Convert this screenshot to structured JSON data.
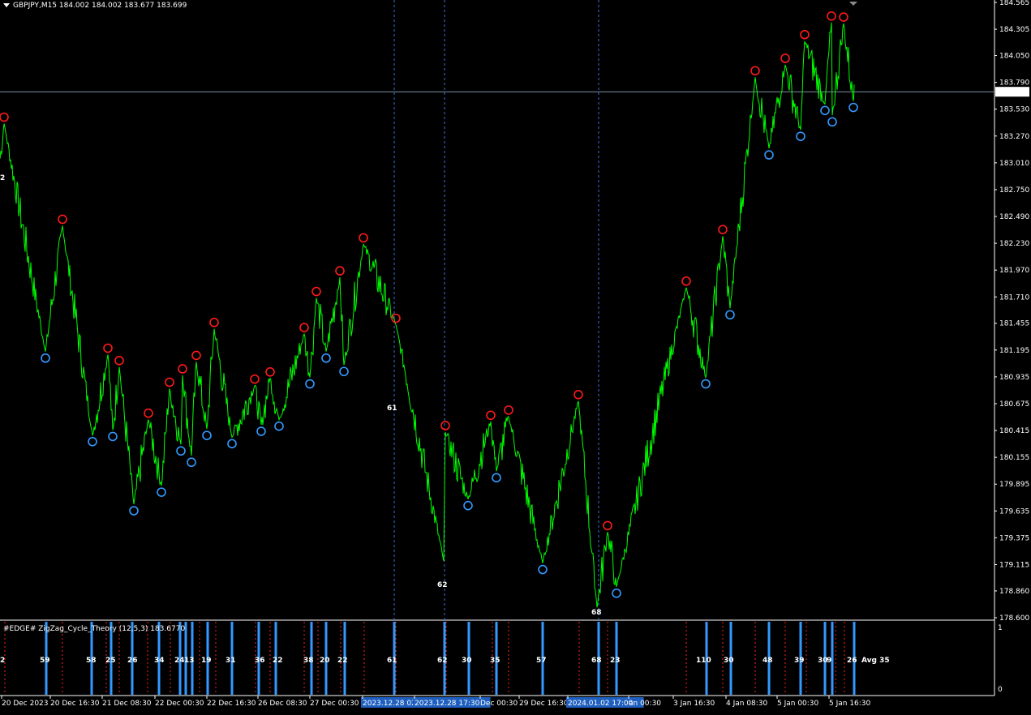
{
  "window": {
    "symbol_header": "GBPJPY,M15  184.002 184.002 183.677 183.699"
  },
  "colors": {
    "background": "#000000",
    "price_line": "#00ff00",
    "high_marker": "#ff1a1a",
    "low_marker": "#3399ff",
    "cycle_bar": "#3399ff",
    "red_dashed": "#ff2020",
    "blue_dashed": "#3a6fd8",
    "axis_text": "#ffffff",
    "current_price_line": "#7f8fa8",
    "time_highlight_bg": "#1e5fbf"
  },
  "price_axis": {
    "labels": [
      "184.565",
      "184.305",
      "184.050",
      "183.790",
      "183.530",
      "183.270",
      "183.010",
      "182.750",
      "182.490",
      "182.230",
      "181.970",
      "181.710",
      "181.455",
      "181.195",
      "180.935",
      "180.675",
      "180.415",
      "180.155",
      "179.895",
      "179.635",
      "179.375",
      "179.115",
      "178.860",
      "178.600"
    ],
    "current_price": "183.699"
  },
  "indicator": {
    "title": "#EDGE# ZigZag_Cycle_Theory (12,5,3) 183.6770",
    "axis_top": "1",
    "axis_bottom": "0",
    "avg_label": "Avg 35"
  },
  "time_axis": {
    "labels": [
      "20 Dec 2023",
      "20 Dec 16:30",
      "21 Dec 08:30",
      "22 Dec 00:30",
      "22 Dec 16:30",
      "26 Dec 08:30",
      "27 Dec 00:30",
      "2023.12.28 02",
      "2023.12.28 17:30",
      "Dec 00:30",
      "29 Dec 16:30",
      "2024.01.02 17:00",
      "an 00:30",
      "3 Jan 16:30",
      "4 Jan 08:30",
      "5 Jan 00:30",
      "5 Jan 16:30"
    ]
  },
  "chart_data": {
    "type": "line",
    "symbol": "GBPJPY",
    "timeframe": "M15",
    "ylim": [
      178.6,
      184.565
    ],
    "swing_highs": [
      {
        "time": "20 Dec 2023",
        "price": 183.39
      },
      {
        "time": "20 Dec 16:30",
        "price": 182.4
      },
      {
        "time": "21 Dec 08:30",
        "price": 181.15
      },
      {
        "time": "21 Dec 08:30",
        "price": 181.03
      },
      {
        "time": "21 Dec 08:30",
        "price": 180.52
      },
      {
        "time": "22 Dec 00:30",
        "price": 180.82
      },
      {
        "time": "22 Dec 00:30",
        "price": 180.95
      },
      {
        "time": "22 Dec 00:30",
        "price": 181.08
      },
      {
        "time": "22 Dec 00:30",
        "price": 181.4
      },
      {
        "time": "22 Dec 16:30",
        "price": 180.85
      },
      {
        "time": "26 Dec 08:30",
        "price": 180.92
      },
      {
        "time": "26 Dec 08:30",
        "price": 181.35
      },
      {
        "time": "27 Dec 00:30",
        "price": 181.7
      },
      {
        "time": "27 Dec 00:30",
        "price": 181.9
      },
      {
        "time": "27 Dec 00:30",
        "price": 182.22
      },
      {
        "time": "2023.12.28 02",
        "price": 181.44
      },
      {
        "time": "2023.12.28 17:30",
        "price": 180.4
      },
      {
        "time": "Dec 00:30",
        "price": 180.5
      },
      {
        "time": "Dec 00:30",
        "price": 180.55
      },
      {
        "time": "29 Dec 16:30",
        "price": 180.7
      },
      {
        "time": "2024.01.02 17:00",
        "price": 179.43
      },
      {
        "time": "3 Jan 16:30",
        "price": 181.8
      },
      {
        "time": "3 Jan 16:30",
        "price": 182.3
      },
      {
        "time": "4 Jan 08:30",
        "price": 183.84
      },
      {
        "time": "4 Jan 08:30",
        "price": 183.96
      },
      {
        "time": "5 Jan 00:30",
        "price": 184.19
      },
      {
        "time": "5 Jan 16:30",
        "price": 184.37
      },
      {
        "time": "5 Jan 16:30",
        "price": 184.36
      }
    ],
    "swing_lows": [
      {
        "time": "20 Dec 16:30",
        "price": 181.18
      },
      {
        "time": "21 Dec 08:30",
        "price": 180.37
      },
      {
        "time": "21 Dec 08:30",
        "price": 180.42
      },
      {
        "time": "21 Dec 08:30",
        "price": 179.7
      },
      {
        "time": "22 Dec 00:30",
        "price": 179.88
      },
      {
        "time": "22 Dec 00:30",
        "price": 180.28
      },
      {
        "time": "22 Dec 00:30",
        "price": 180.17
      },
      {
        "time": "22 Dec 16:30",
        "price": 180.43
      },
      {
        "time": "22 Dec 16:30",
        "price": 180.35
      },
      {
        "time": "26 Dec 08:30",
        "price": 180.47
      },
      {
        "time": "26 Dec 08:30",
        "price": 180.52
      },
      {
        "time": "27 Dec 00:30",
        "price": 180.93
      },
      {
        "time": "27 Dec 00:30",
        "price": 181.18
      },
      {
        "time": "27 Dec 00:30",
        "price": 181.05
      },
      {
        "time": "2023.12.28 17:30",
        "price": 179.75
      },
      {
        "time": "Dec 00:30",
        "price": 180.02
      },
      {
        "time": "29 Dec 16:30",
        "price": 179.13
      },
      {
        "time": "2024.01.02 17:00",
        "price": 178.9
      },
      {
        "time": "3 Jan 16:30",
        "price": 180.93
      },
      {
        "time": "3 Jan 16:30",
        "price": 181.6
      },
      {
        "time": "4 Jan 08:30",
        "price": 183.15
      },
      {
        "time": "5 Jan 00:30",
        "price": 183.33
      },
      {
        "time": "5 Jan 16:30",
        "price": 183.58
      },
      {
        "time": "5 Jan 16:30",
        "price": 183.47
      },
      {
        "time": "5 Jan 16:30",
        "price": 183.61
      }
    ],
    "price_labels": [
      "2",
      "61",
      "62",
      "68"
    ],
    "cycle_counts": [
      "2",
      "59",
      "58",
      "25",
      "26",
      "34",
      "24",
      "13",
      "19",
      "31",
      "36",
      "22",
      "38",
      "20",
      "22",
      "61",
      "62",
      "30",
      "35",
      "57",
      "68",
      "23",
      "110",
      "30",
      "48",
      "39",
      "30",
      "9",
      "26"
    ]
  }
}
